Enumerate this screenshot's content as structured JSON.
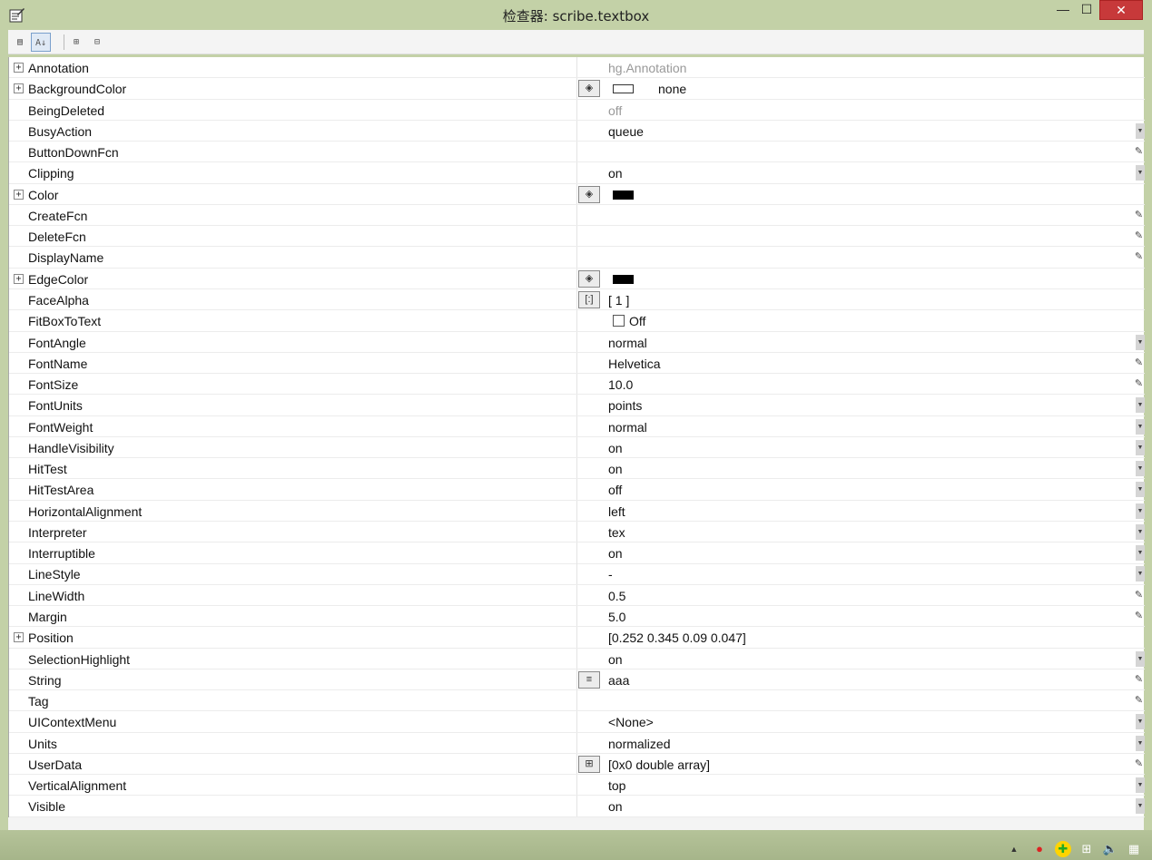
{
  "window": {
    "title": "检查器:  scribe.textbox",
    "minimize_glyph": "—",
    "maximize_glyph": "☐",
    "close_glyph": "✕"
  },
  "toolbar": {
    "buttons": [
      {
        "icon": "categorized-view-icon",
        "glyph": "▤"
      },
      {
        "icon": "alphabetical-sort-icon",
        "glyph": "A↓"
      },
      {
        "icon": "expand-all-icon",
        "glyph": "⊞"
      },
      {
        "icon": "collapse-all-icon",
        "glyph": "⊟"
      }
    ]
  },
  "properties": [
    {
      "name": "Annotation",
      "expandable": true,
      "value": "hg.Annotation",
      "muted": true,
      "editor": null,
      "control": null
    },
    {
      "name": "BackgroundColor",
      "expandable": true,
      "value": "none",
      "muted": false,
      "editor": "color",
      "control": "swatch-none"
    },
    {
      "name": "BeingDeleted",
      "expandable": false,
      "value": "off",
      "muted": true,
      "editor": null,
      "control": null
    },
    {
      "name": "BusyAction",
      "expandable": false,
      "value": "queue",
      "muted": false,
      "editor": null,
      "control": "dropdown"
    },
    {
      "name": "ButtonDownFcn",
      "expandable": false,
      "value": "",
      "muted": false,
      "editor": null,
      "control": "pencil"
    },
    {
      "name": "Clipping",
      "expandable": false,
      "value": "on",
      "muted": false,
      "editor": null,
      "control": "dropdown"
    },
    {
      "name": "Color",
      "expandable": true,
      "value": "",
      "muted": false,
      "editor": "color",
      "control": "swatch-black"
    },
    {
      "name": "CreateFcn",
      "expandable": false,
      "value": "",
      "muted": false,
      "editor": null,
      "control": "pencil"
    },
    {
      "name": "DeleteFcn",
      "expandable": false,
      "value": "",
      "muted": false,
      "editor": null,
      "control": "pencil"
    },
    {
      "name": "DisplayName",
      "expandable": false,
      "value": "",
      "muted": false,
      "editor": null,
      "control": "pencil"
    },
    {
      "name": "EdgeColor",
      "expandable": true,
      "value": "",
      "muted": false,
      "editor": "color",
      "control": "swatch-black"
    },
    {
      "name": "FaceAlpha",
      "expandable": false,
      "value": "[ 1 ]",
      "muted": false,
      "editor": "array",
      "control": null
    },
    {
      "name": "FitBoxToText",
      "expandable": false,
      "value": "Off",
      "muted": false,
      "editor": null,
      "control": "checkbox"
    },
    {
      "name": "FontAngle",
      "expandable": false,
      "value": "normal",
      "muted": false,
      "editor": null,
      "control": "dropdown"
    },
    {
      "name": "FontName",
      "expandable": false,
      "value": "Helvetica",
      "muted": false,
      "editor": null,
      "control": "pencil"
    },
    {
      "name": "FontSize",
      "expandable": false,
      "value": "10.0",
      "muted": false,
      "editor": null,
      "control": "pencil"
    },
    {
      "name": "FontUnits",
      "expandable": false,
      "value": "points",
      "muted": false,
      "editor": null,
      "control": "dropdown"
    },
    {
      "name": "FontWeight",
      "expandable": false,
      "value": "normal",
      "muted": false,
      "editor": null,
      "control": "dropdown"
    },
    {
      "name": "HandleVisibility",
      "expandable": false,
      "value": "on",
      "muted": false,
      "editor": null,
      "control": "dropdown"
    },
    {
      "name": "HitTest",
      "expandable": false,
      "value": "on",
      "muted": false,
      "editor": null,
      "control": "dropdown"
    },
    {
      "name": "HitTestArea",
      "expandable": false,
      "value": "off",
      "muted": false,
      "editor": null,
      "control": "dropdown"
    },
    {
      "name": "HorizontalAlignment",
      "expandable": false,
      "value": "left",
      "muted": false,
      "editor": null,
      "control": "dropdown"
    },
    {
      "name": "Interpreter",
      "expandable": false,
      "value": "tex",
      "muted": false,
      "editor": null,
      "control": "dropdown"
    },
    {
      "name": "Interruptible",
      "expandable": false,
      "value": "on",
      "muted": false,
      "editor": null,
      "control": "dropdown"
    },
    {
      "name": "LineStyle",
      "expandable": false,
      "value": "-",
      "muted": false,
      "editor": null,
      "control": "dropdown"
    },
    {
      "name": "LineWidth",
      "expandable": false,
      "value": "0.5",
      "muted": false,
      "editor": null,
      "control": "pencil"
    },
    {
      "name": "Margin",
      "expandable": false,
      "value": "5.0",
      "muted": false,
      "editor": null,
      "control": "pencil"
    },
    {
      "name": "Position",
      "expandable": true,
      "value": "[0.252 0.345 0.09 0.047]",
      "muted": false,
      "editor": null,
      "control": null
    },
    {
      "name": "SelectionHighlight",
      "expandable": false,
      "value": "on",
      "muted": false,
      "editor": null,
      "control": "dropdown"
    },
    {
      "name": "String",
      "expandable": false,
      "value": "aaa",
      "muted": false,
      "editor": "text",
      "control": "pencil"
    },
    {
      "name": "Tag",
      "expandable": false,
      "value": "",
      "muted": false,
      "editor": null,
      "control": "pencil"
    },
    {
      "name": "UIContextMenu",
      "expandable": false,
      "value": "<None>",
      "muted": false,
      "editor": null,
      "control": "dropdown"
    },
    {
      "name": "Units",
      "expandable": false,
      "value": "normalized",
      "muted": false,
      "editor": null,
      "control": "dropdown"
    },
    {
      "name": "UserData",
      "expandable": false,
      "value": "[0x0  double array]",
      "muted": false,
      "editor": "matrix",
      "control": "pencil"
    },
    {
      "name": "VerticalAlignment",
      "expandable": false,
      "value": "top",
      "muted": false,
      "editor": null,
      "control": "dropdown"
    },
    {
      "name": "Visible",
      "expandable": false,
      "value": "on",
      "muted": false,
      "editor": null,
      "control": "dropdown"
    }
  ],
  "editor_glyphs": {
    "color": "◈",
    "array": "[:]",
    "text": "≡",
    "matrix": "⊞"
  },
  "taskbar": {
    "tray": [
      {
        "icon": "show-hidden-icons-icon",
        "glyph": "▲"
      },
      {
        "icon": "qq-icon",
        "glyph": "●"
      },
      {
        "icon": "security-icon",
        "glyph": "✚"
      },
      {
        "icon": "windows-flag-icon",
        "glyph": "⊞"
      },
      {
        "icon": "volume-icon",
        "glyph": "🔈"
      },
      {
        "icon": "network-icon",
        "glyph": "▦"
      }
    ]
  }
}
